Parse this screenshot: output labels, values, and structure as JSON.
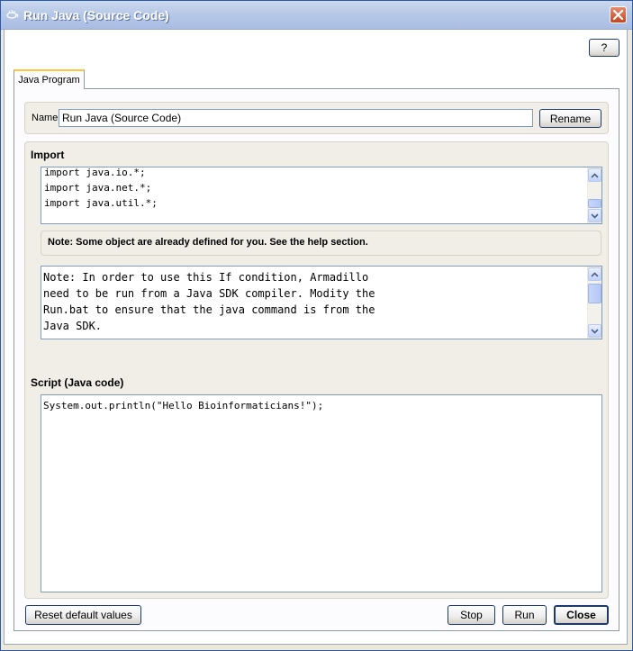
{
  "window": {
    "title": "Run Java (Source Code)"
  },
  "header": {
    "help_label": "?"
  },
  "tabs": [
    {
      "label": "Java Program",
      "active": true
    }
  ],
  "name_row": {
    "label": "Name",
    "value": "Run Java (Source Code)",
    "rename_label": "Rename"
  },
  "import_section": {
    "label": "Import",
    "lines": [
      "import java.io.*;",
      "import java.net.*;",
      "import java.util.*;"
    ]
  },
  "note": {
    "text": "Note: Some object are already defined for you. See the help section."
  },
  "condition_text": {
    "lines": [
      "Note: In order to use this If condition, Armadillo",
      "need to be run from a Java SDK compiler. Modity the",
      "Run.bat to ensure that the java command is from the",
      "Java SDK."
    ]
  },
  "script_section": {
    "label": "Script (Java code)",
    "lines": [
      "System.out.println(\"Hello Bioinformaticians!\");"
    ]
  },
  "footer": {
    "reset_label": "Reset default values",
    "stop_label": "Stop",
    "run_label": "Run",
    "close_label": "Close"
  },
  "colors": {
    "titlebar": "#b7c9e8",
    "tab_accent": "#ffc83c",
    "button_border": "#1c3a6e",
    "field_border": "#7f9db9"
  },
  "icons": {
    "app": "coffee-cup-icon",
    "close": "close-icon",
    "scroll_up": "arrow-up-icon",
    "scroll_down": "arrow-down-icon"
  }
}
